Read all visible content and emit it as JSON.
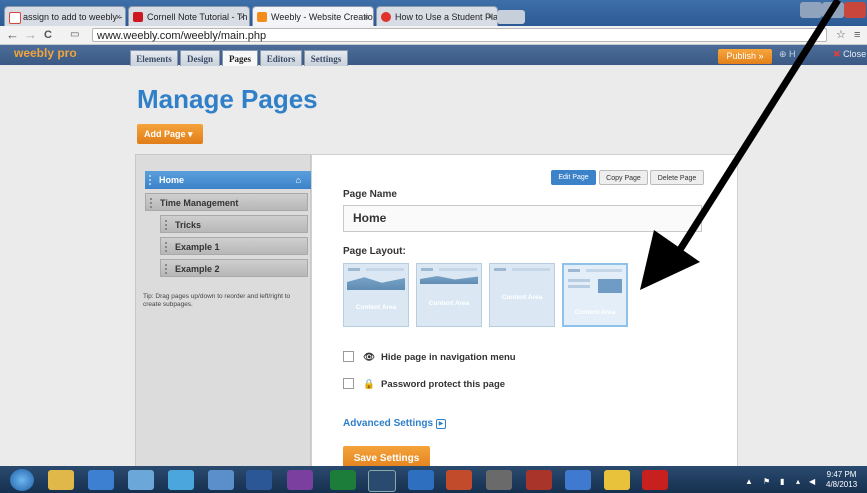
{
  "browser": {
    "tabs": [
      {
        "label": "assign to add to weebly -",
        "favicon_color": "#d44638"
      },
      {
        "label": "Cornell Note Tutorial - Th",
        "favicon_color": "#cc181e"
      },
      {
        "label": "Weebly - Website Creation",
        "favicon_color": "#f28c1a"
      },
      {
        "label": "How to Use a Student Pla",
        "favicon_color": "#e0312c"
      }
    ],
    "url": "www.weebly.com/weebly/main.php",
    "back": "←",
    "forward": "→",
    "reload": "C"
  },
  "weebly_bar": {
    "logo": "weebly pro",
    "tabs": [
      "Elements",
      "Design",
      "Pages",
      "Editors",
      "Settings"
    ],
    "publish": "Publish »",
    "help": "H",
    "close": "Close"
  },
  "page": {
    "title": "Manage Pages",
    "add_page": "Add Page ▾",
    "pages": [
      "Home",
      "Time Management",
      "Tricks",
      "Example 1",
      "Example 2"
    ],
    "tip": "Tip: Drag pages up/down to reorder and left/right to create subpages.",
    "buttons": {
      "edit": "Edit Page",
      "copy": "Copy Page",
      "delete": "Delete Page"
    },
    "page_name_label": "Page Name",
    "page_name_value": "Home",
    "page_layout_label": "Page Layout:",
    "layouts": [
      "Content Area",
      "Content Area",
      "Content Area",
      "Content Area"
    ],
    "hide_nav": "Hide page in navigation menu",
    "password": "Password protect this page",
    "advanced": "Advanced Settings",
    "save": "Save Settings"
  },
  "taskbar": {
    "time": "9:47 PM",
    "date": "4/8/2013"
  }
}
